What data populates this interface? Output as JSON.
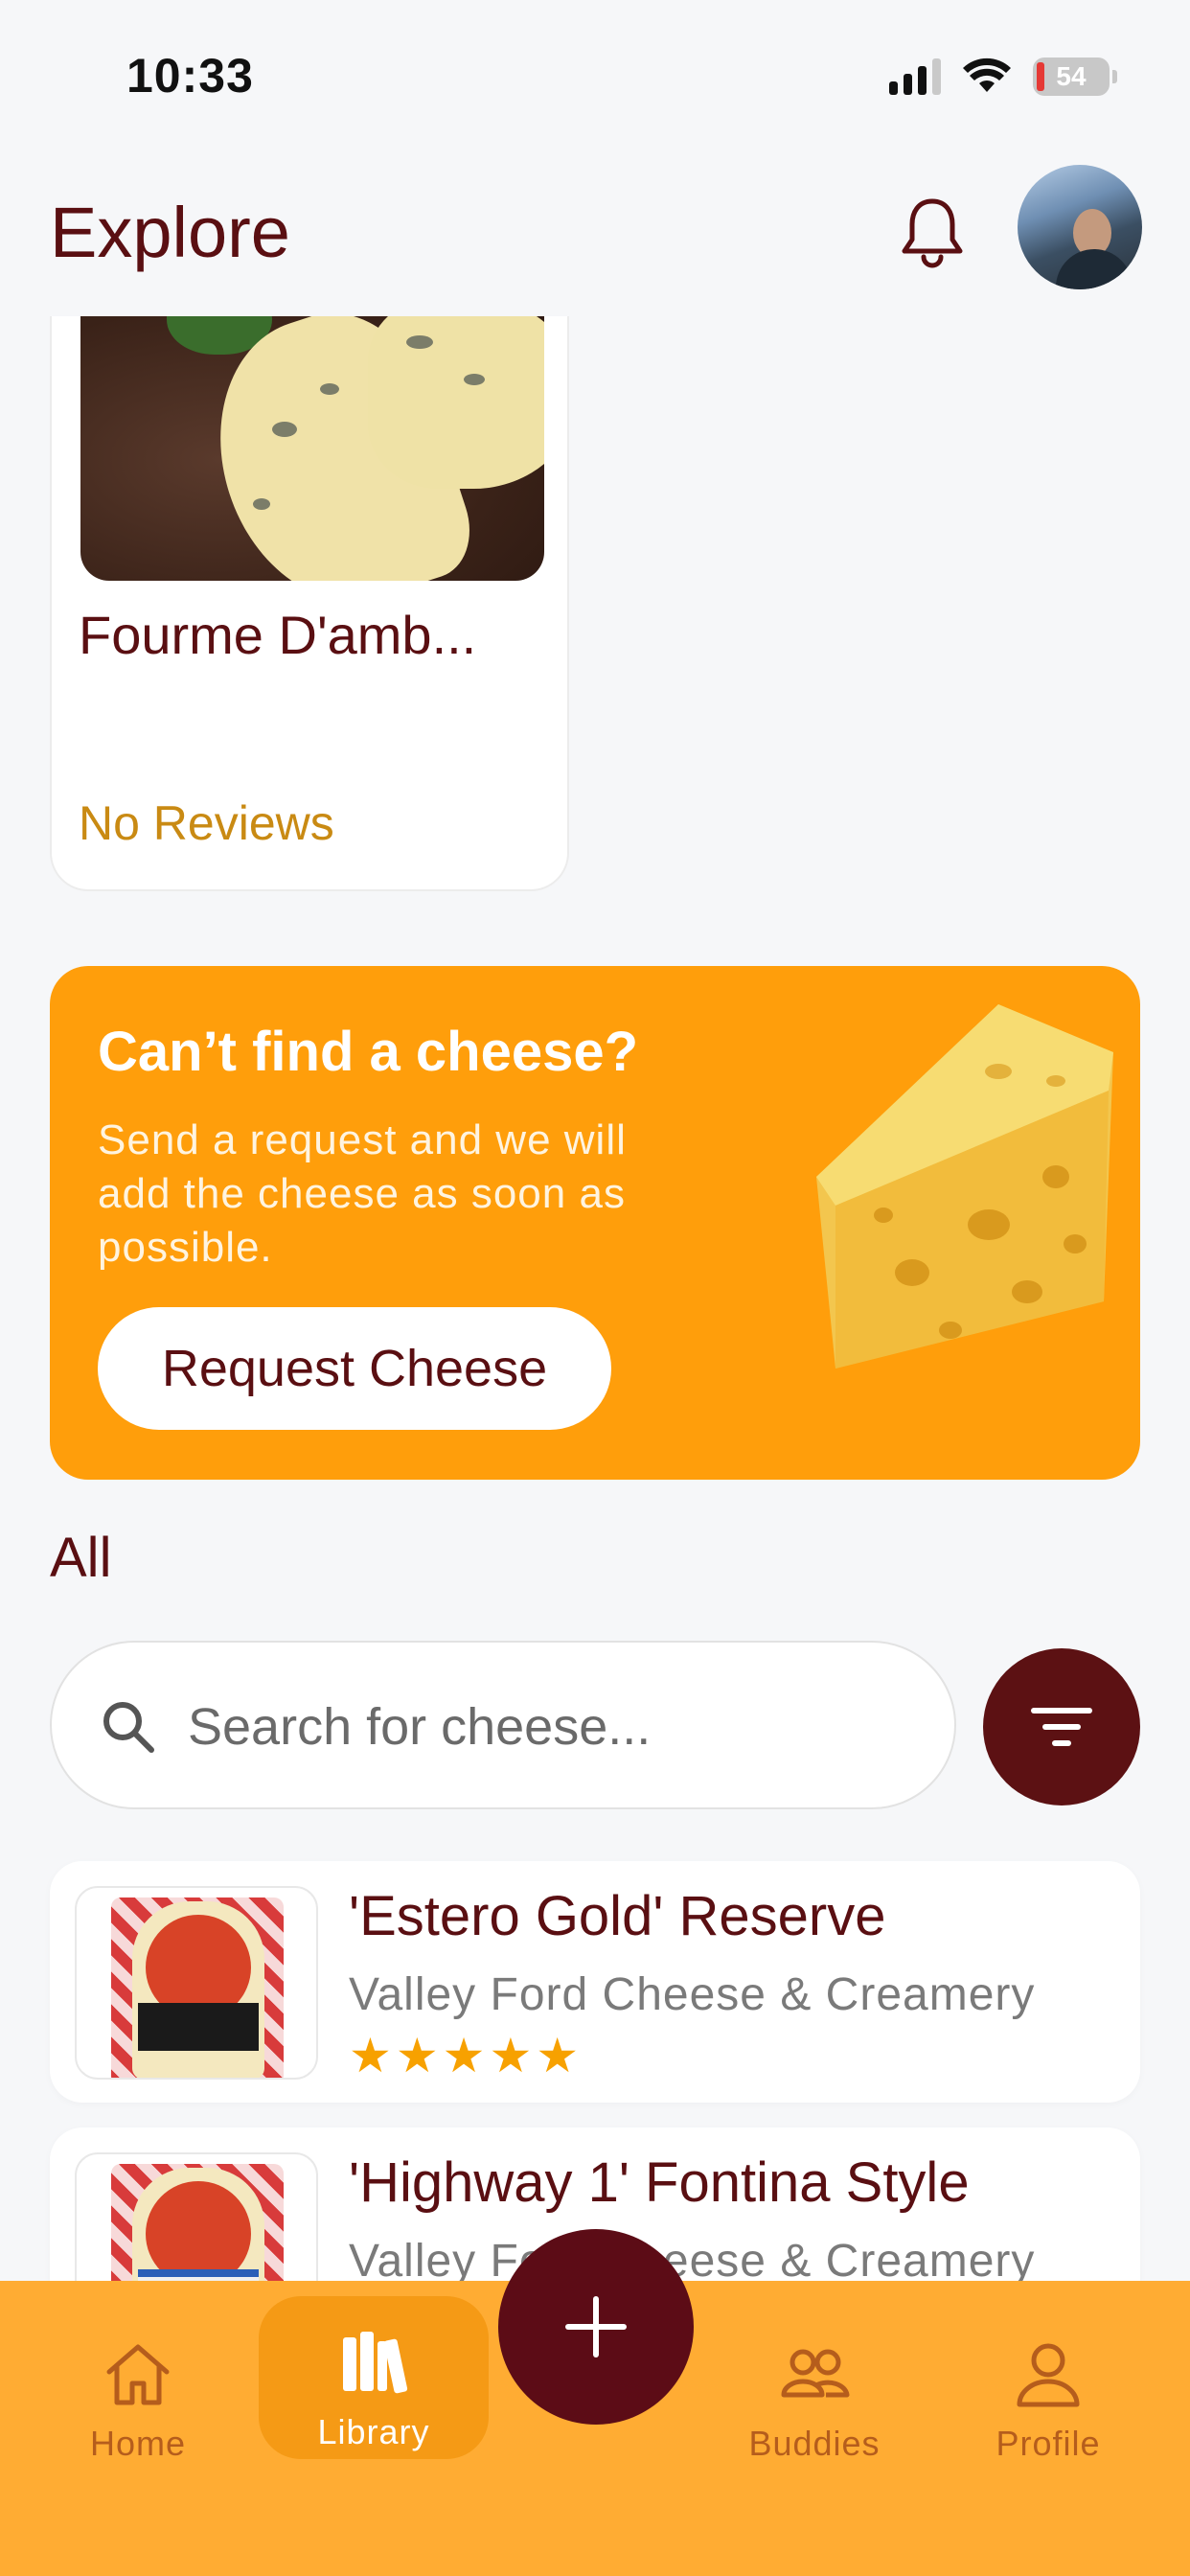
{
  "status_bar": {
    "time": "10:33",
    "battery": "54"
  },
  "header": {
    "title": "Explore"
  },
  "featured_card": {
    "name": "Fourme D'amb...",
    "reviews": "No Reviews"
  },
  "promo": {
    "title": "Can’t find a cheese?",
    "text": "Send a request and we will add the cheese as soon as possible.",
    "button": "Request Cheese"
  },
  "section": {
    "title": "All"
  },
  "search": {
    "placeholder": "Search for cheese..."
  },
  "cheeses": [
    {
      "name": "'Estero Gold' Reserve",
      "maker": "Valley Ford Cheese & Creamery",
      "rating": "★★★★★"
    },
    {
      "name": "'Highway 1' Fontina Style",
      "maker": "Valley Ford Cheese & Creamery"
    }
  ],
  "nav": {
    "home": "Home",
    "library": "Library",
    "buddies": "Buddies",
    "profile": "Profile"
  },
  "colors": {
    "accent": "#5a0f12",
    "promo": "#ff9e0b",
    "nav": "#ffac33",
    "star": "#f7a100"
  }
}
